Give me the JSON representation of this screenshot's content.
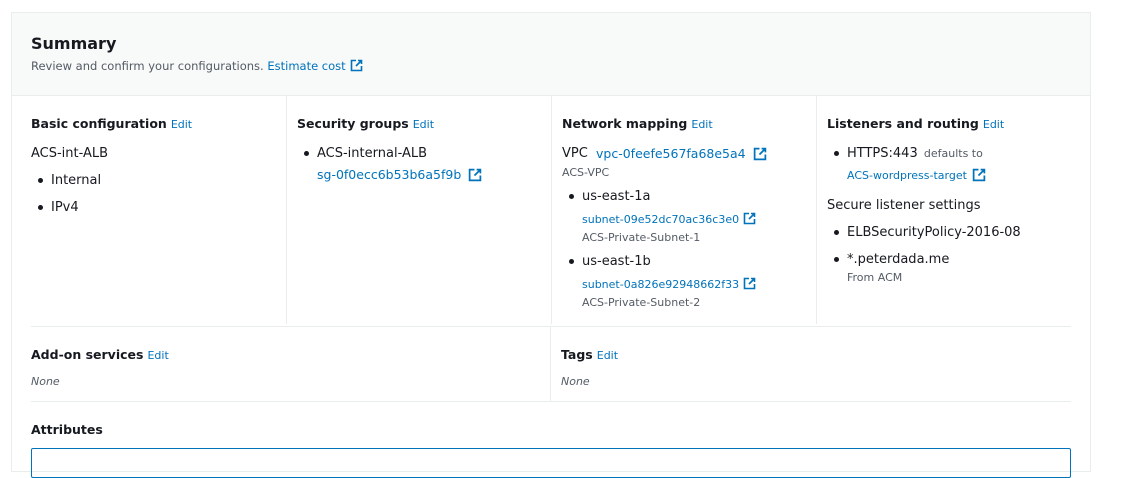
{
  "summary": {
    "title": "Summary",
    "description": "Review and confirm your configurations.",
    "estimate_cost": "Estimate cost"
  },
  "basic": {
    "title": "Basic configuration",
    "edit": "Edit",
    "name": "ACS-int-ALB",
    "items": [
      "Internal",
      "IPv4"
    ]
  },
  "security": {
    "title": "Security groups",
    "edit": "Edit",
    "group_name": "ACS-internal-ALB",
    "group_id": "sg-0f0ecc6b53b6a5f9b"
  },
  "network": {
    "title": "Network mapping",
    "edit": "Edit",
    "vpc_label": "VPC",
    "vpc_id": "vpc-0feefe567fa68e5a4",
    "vpc_name": "ACS-VPC",
    "zones": [
      {
        "zone": "us-east-1a",
        "subnet": "subnet-09e52dc70ac36c3e0",
        "subnet_name": "ACS-Private-Subnet-1"
      },
      {
        "zone": "us-east-1b",
        "subnet": "subnet-0a826e92948662f33",
        "subnet_name": "ACS-Private-Subnet-2"
      }
    ]
  },
  "listeners": {
    "title": "Listeners and routing",
    "edit": "Edit",
    "listener": "HTTPS:443",
    "defaults_to": "defaults to",
    "target": "ACS-wordpress-target",
    "secure_title": "Secure listener settings",
    "policy": "ELBSecurityPolicy-2016-08",
    "cert": "*.peterdada.me",
    "cert_source": "From ACM"
  },
  "addons": {
    "title": "Add-on services",
    "edit": "Edit",
    "value": "None"
  },
  "tags": {
    "title": "Tags",
    "edit": "Edit",
    "value": "None"
  },
  "attributes": {
    "title": "Attributes"
  },
  "colors": {
    "link": "#0073bb",
    "header_bg": "#f8f9f9",
    "divider": "#eaeded"
  }
}
